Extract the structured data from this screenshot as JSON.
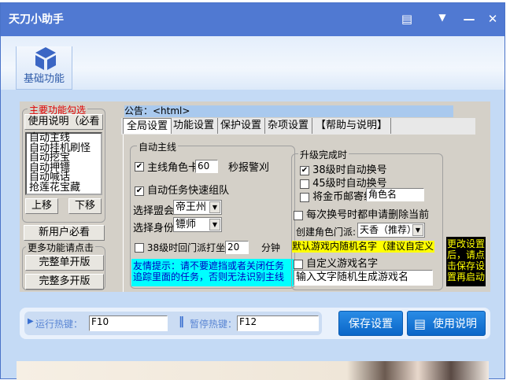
{
  "window": {
    "title": "天刀小助手"
  },
  "toolbar": {
    "basic_label": "基础功能"
  },
  "left": {
    "group_title": "主要功能勾选",
    "manual_btn": "使用说明（必看",
    "features": [
      "自动主线",
      "自动挂机刷怪",
      "自动挖宝",
      "自动押镖",
      "自动喊话",
      "抢莲花宝藏"
    ],
    "up_btn": "上移",
    "down_btn": "下移",
    "newuser_btn": "新用户必看",
    "more_title": "更多功能请点击",
    "single_btn": "完整单开版",
    "multi_btn": "完整多开版"
  },
  "notice": "公告：<html>",
  "tabs": [
    "全局设置",
    "功能设置",
    "保护设置",
    "杂项设置",
    "【帮助与说明】"
  ],
  "main_quest": {
    "title": "自动主线",
    "role_label": "主线角色卡",
    "role_value": "60",
    "role_suffix": "秒报警刈",
    "auto_team": "自动任务快速组队",
    "guild_label": "选择盟会",
    "guild_value": "帝王州",
    "identity_label": "选择身份",
    "identity_value": "镖师",
    "lv38_label": "38级时回门派打坐",
    "lv38_value": "20",
    "lv38_suffix": "分钟",
    "tip": "友情提示：请不要遮挡或者关闭任务追踪里面的任务，否则无法识别主线"
  },
  "upgrade": {
    "title": "升级完成时",
    "lv38": "38级时自动换号",
    "lv45": "45级时自动换号",
    "mail": "将金币邮寄给",
    "mail_value": "角色名",
    "delete": "每次换号时都申请删除当前",
    "school_label": "创建角色门派:",
    "school_value": "天香（推荐）",
    "random_name": "默认游戏内随机名字（建议自定义",
    "custom_name": "自定义游戏名字",
    "name_input": "输入文字随机生成游戏名"
  },
  "note": "更改设置后，请点击保存设置再启动",
  "hotkeys": {
    "run_label": "运行热键：",
    "run_value": "F10",
    "pause_label": "暂停热键：",
    "pause_value": "F12",
    "save_btn": "保存设置",
    "manual_btn": "使用说明"
  }
}
